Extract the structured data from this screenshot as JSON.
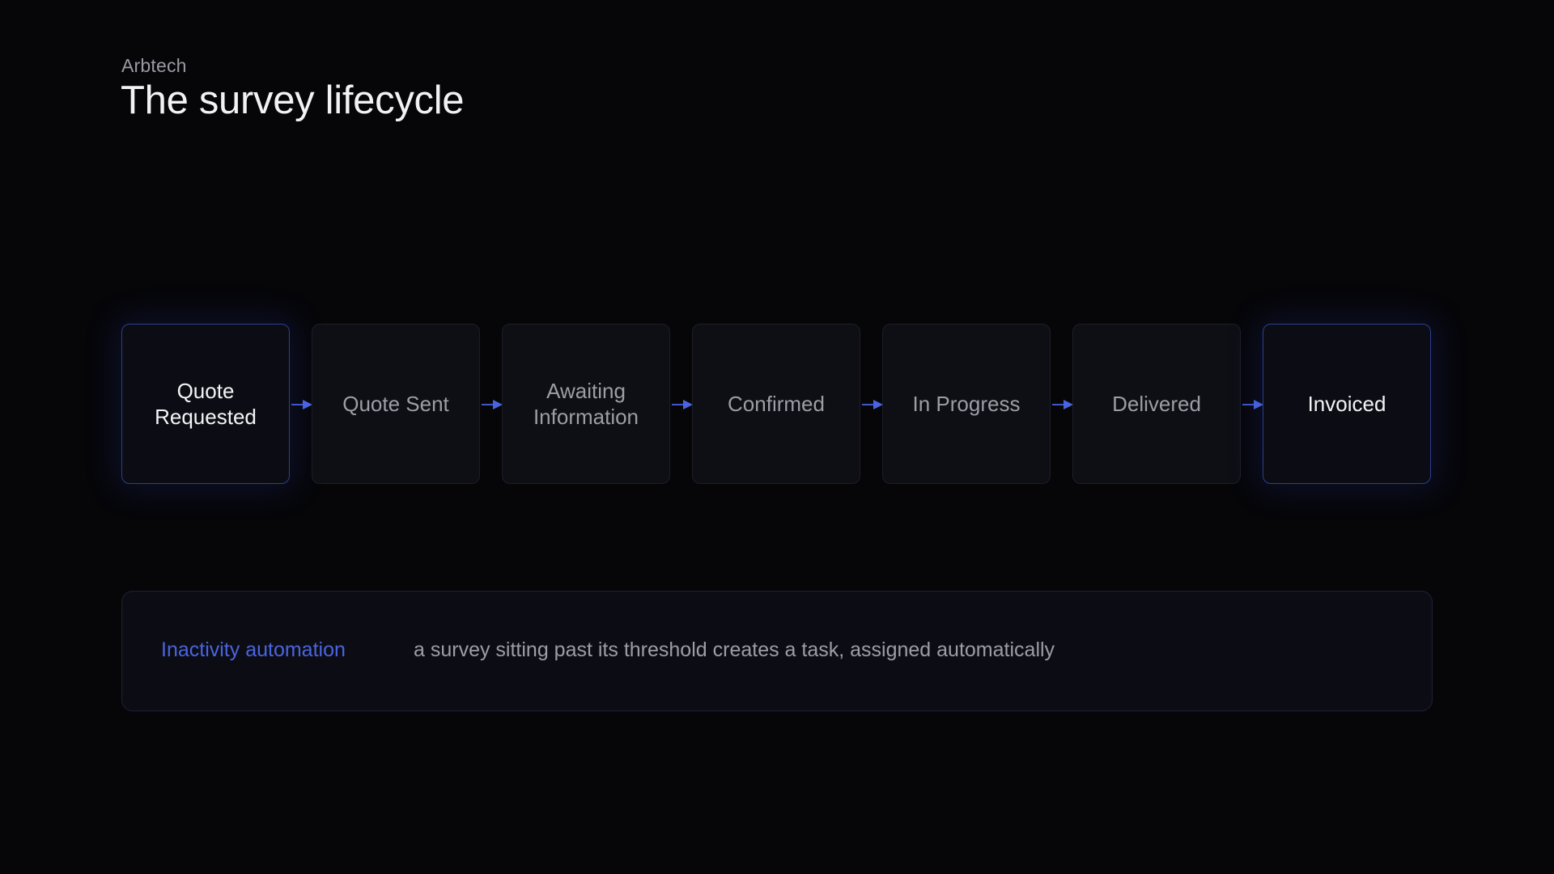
{
  "header": {
    "brand": "Arbtech",
    "title": "The survey lifecycle"
  },
  "stages": [
    {
      "label": "Quote Requested",
      "highlight": true
    },
    {
      "label": "Quote Sent",
      "highlight": false
    },
    {
      "label": "Awaiting Information",
      "highlight": false
    },
    {
      "label": "Confirmed",
      "highlight": false
    },
    {
      "label": "In Progress",
      "highlight": false
    },
    {
      "label": "Delivered",
      "highlight": false
    },
    {
      "label": "Invoiced",
      "highlight": true
    }
  ],
  "automation": {
    "label": "Inactivity automation",
    "description": "a survey sitting past its threshold creates a task, assigned automatically"
  },
  "colors": {
    "background": "#060609",
    "accent": "#4a64e0",
    "highlight_border": "#2c3f8f",
    "box_fill": "#0e0f14"
  },
  "icons": {
    "connector": "arrow-right-icon"
  }
}
